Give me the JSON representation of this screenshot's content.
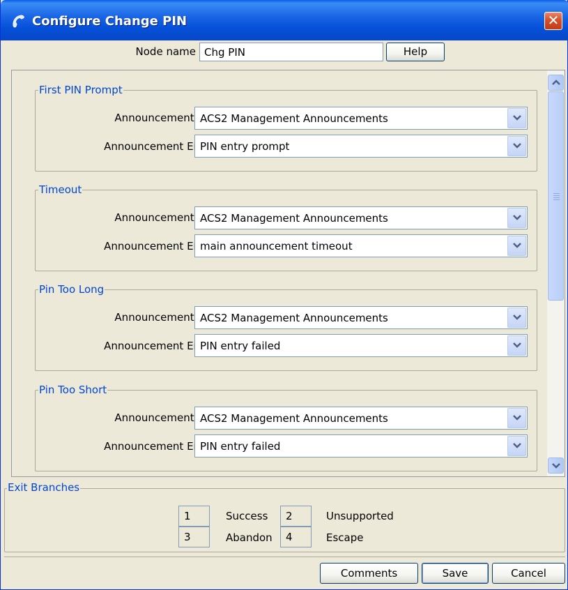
{
  "window": {
    "title": "Configure Change PIN",
    "close_glyph": "✕"
  },
  "node": {
    "label": "Node name",
    "value": "Chg PIN",
    "help_label": "Help"
  },
  "sections": [
    {
      "legend": "First PIN Prompt",
      "set_label": "Announcement Set",
      "set_value": "ACS2 Management Announcements",
      "entry_label": "Announcement Entry",
      "entry_value": "PIN entry prompt"
    },
    {
      "legend": "Timeout",
      "set_label": "Announcement Set",
      "set_value": "ACS2 Management Announcements",
      "entry_label": "Announcement Entry",
      "entry_value": "main announcement timeout"
    },
    {
      "legend": "Pin Too Long",
      "set_label": "Announcement Set",
      "set_value": "ACS2 Management Announcements",
      "entry_label": "Announcement Entry",
      "entry_value": "PIN entry failed"
    },
    {
      "legend": "Pin Too Short",
      "set_label": "Announcement Set",
      "set_value": "ACS2 Management Announcements",
      "entry_label": "Announcement Entry",
      "entry_value": "PIN entry failed"
    }
  ],
  "exit_branches": {
    "legend": "Exit Branches",
    "items": [
      {
        "num": "1",
        "label": "Success"
      },
      {
        "num": "2",
        "label": "Unsupported"
      },
      {
        "num": "3",
        "label": "Abandon"
      },
      {
        "num": "4",
        "label": "Escape"
      }
    ]
  },
  "footer": {
    "comments_label": "Comments",
    "save_label": "Save",
    "cancel_label": "Cancel"
  },
  "icons": {
    "title_icon": "phone-handset-icon",
    "dropdown": "chevron-down-icon",
    "scroll_up": "chevron-up-icon",
    "scroll_down": "chevron-down-icon"
  },
  "colors": {
    "titlebar": "#0a5fe8",
    "legend_text": "#0046d5",
    "close_button": "#d4502a",
    "background": "#ece9d8"
  }
}
